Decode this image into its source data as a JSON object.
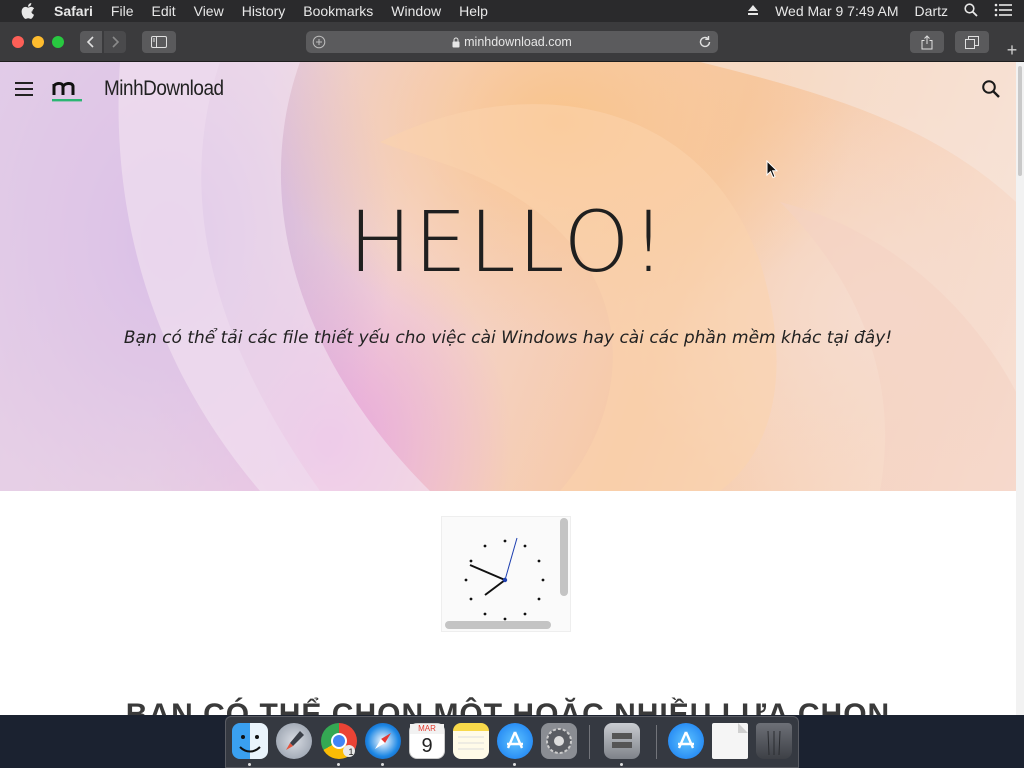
{
  "menubar": {
    "app_name": "Safari",
    "menus": [
      "File",
      "Edit",
      "View",
      "History",
      "Bookmarks",
      "Window",
      "Help"
    ],
    "datetime": "Wed Mar 9  7:49 AM",
    "user": "Dartz"
  },
  "browser": {
    "url": "minhdownload.com",
    "new_tab": "+"
  },
  "site": {
    "brand": "MinhDownload",
    "hero_title": "HELLO!",
    "hero_subtitle": "Bạn có thể tải các file thiết yếu cho việc cài Windows hay cài các phần mềm khác tại đây!",
    "section_heading": "BẠN CÓ THỂ CHỌN MỘT HOẶC NHIỀU LỰA CHỌN"
  },
  "dock": {
    "calendar_month": "MAR",
    "calendar_day": "9",
    "chrome_badge": "1",
    "apps": [
      "finder-icon",
      "launchpad-icon",
      "chrome-icon",
      "safari-icon",
      "calendar-icon",
      "notes-icon",
      "app-store-icon",
      "system-preferences-icon",
      "disk-utility-icon",
      "app-store-folder-icon",
      "document-icon",
      "trash-icon"
    ]
  },
  "colors": {
    "menubar_bg": "#2a2a2c",
    "toolbar_bg": "#3b3b3d",
    "accent_green": "#2bb673"
  }
}
